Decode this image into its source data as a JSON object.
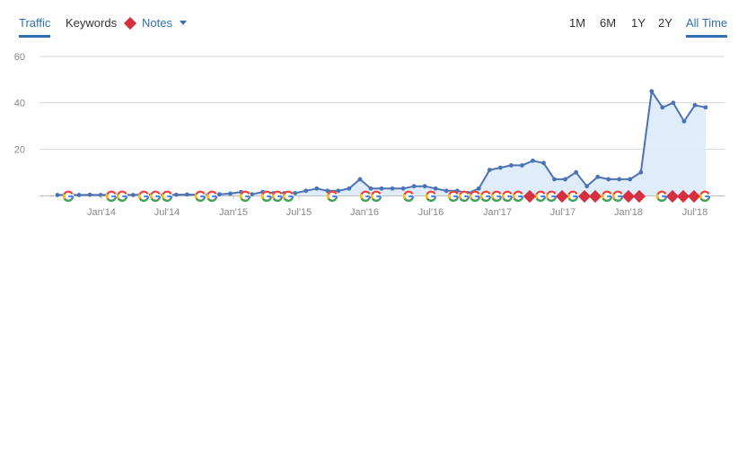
{
  "tabs": {
    "traffic": "Traffic",
    "keywords": "Keywords",
    "notes": "Notes"
  },
  "ranges": [
    "1M",
    "6M",
    "1Y",
    "2Y",
    "All Time"
  ],
  "active_range": "All Time",
  "colors": {
    "line": "#4a72b5",
    "area": "#dcebfb",
    "note": "#d6303e",
    "accent": "#2f6fb5"
  },
  "icons": [
    "google-update-icon",
    "note-diamond-icon",
    "chevron-down-icon"
  ],
  "chart_data": {
    "type": "area",
    "title": "",
    "xlabel": "",
    "ylabel": "",
    "ylim": [
      0,
      60
    ],
    "yticks": [
      20,
      40,
      60
    ],
    "grid": true,
    "x_tick_labels": [
      "Jan'14",
      "Jul'14",
      "Jan'15",
      "Jul'15",
      "Jan'16",
      "Jul'16",
      "Jan'17",
      "Jul'17",
      "Jan'18",
      "Jul'18"
    ],
    "series": [
      {
        "values": [
          0.2,
          0.3,
          0.2,
          0.3,
          0.2,
          0.3,
          0.4,
          0.2,
          0.5,
          0.3,
          0.3,
          0.3,
          0.4,
          0.3,
          0.3,
          0.5,
          0.8,
          1.5,
          0.5,
          1.5,
          1.0,
          1.0,
          1.0,
          2.0,
          3.0,
          2.0,
          2.0,
          3.0,
          7.0,
          3.0,
          3.0,
          3.0,
          3.0,
          4.0,
          4.0,
          3.0,
          2.0,
          2.0,
          1.0,
          3.0,
          11.0,
          12.0,
          13.0,
          13.0,
          15.0,
          14.0,
          7.0,
          7.0,
          10.0,
          4.0,
          8.0,
          7.0,
          7.0,
          7.0,
          10.0,
          45.0,
          38.0,
          40.0,
          32.0,
          39.0,
          38.0
        ]
      }
    ],
    "google_updates": 39,
    "notes": 9
  }
}
